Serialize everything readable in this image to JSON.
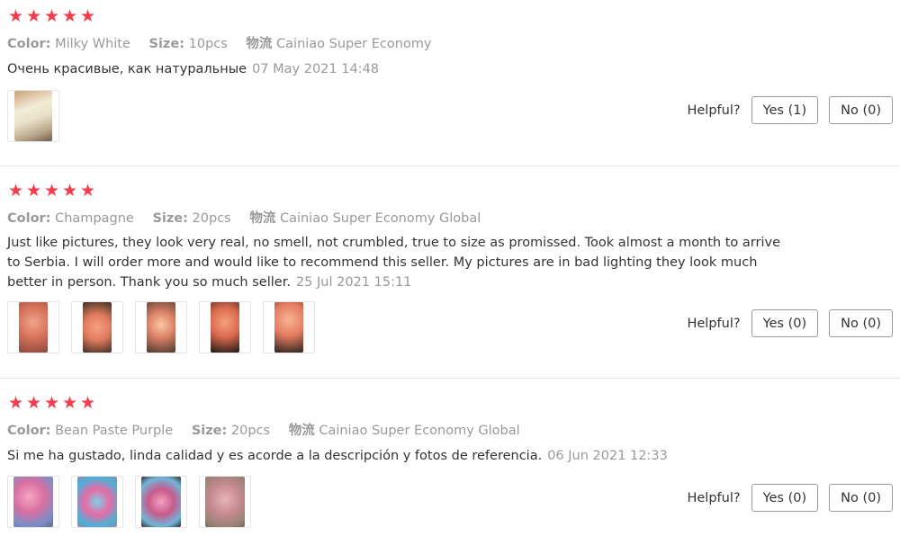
{
  "colors": {
    "star": "#f23d4d",
    "muted": "#999999",
    "text": "#333333"
  },
  "labels": {
    "color": "Color:",
    "size": "Size:",
    "ship": "物流",
    "helpful": "Helpful?"
  },
  "reviews": [
    {
      "rating": 5,
      "color": "Milky White",
      "size": "10pcs",
      "shipping": "Cainiao Super Economy",
      "text": "Очень красивые, как натуральные",
      "date": "07 May 2021 14:48",
      "photos": [
        "photo-1"
      ],
      "yes": "Yes (1)",
      "no": "No (0)"
    },
    {
      "rating": 5,
      "color": "Champagne",
      "size": "20pcs",
      "shipping": "Cainiao Super Economy Global",
      "text": "Just like pictures, they look very real, no smell, not crumbled, true to size as promissed. Took almost a month to arrive to Serbia. I will order more and would like to recommend this seller. My pictures are in bad lighting they look much better in person. Thank you so much seller.",
      "date": "25 Jul 2021 15:11",
      "photos": [
        "photo-1",
        "photo-2",
        "photo-3",
        "photo-4",
        "photo-5"
      ],
      "yes": "Yes (0)",
      "no": "No (0)"
    },
    {
      "rating": 5,
      "color": "Bean Paste Purple",
      "size": "20pcs",
      "shipping": "Cainiao Super Economy Global",
      "text": "Si me ha gustado, linda calidad y es acorde a la descripción y fotos de referencia.",
      "date": "06 Jun 2021 12:33",
      "photos": [
        "photo-1",
        "photo-2",
        "photo-3",
        "photo-4"
      ],
      "yes": "Yes (0)",
      "no": "No (0)"
    }
  ]
}
